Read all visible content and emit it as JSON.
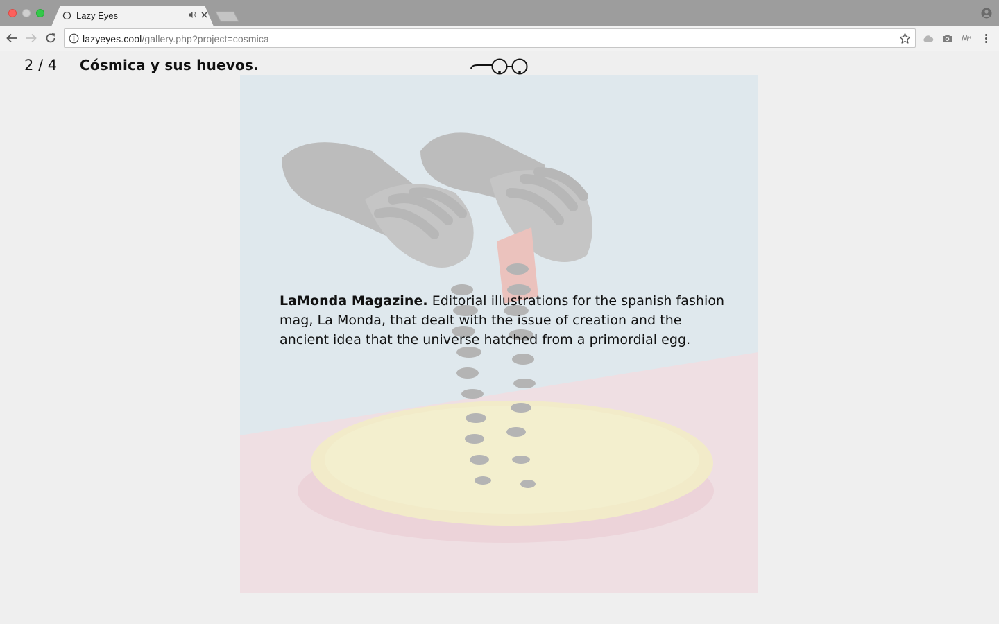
{
  "browser": {
    "tab": {
      "title": "Lazy Eyes"
    },
    "address_bar": {
      "host": "lazyeyes.cool",
      "path": "/gallery.php?project=cosmica"
    },
    "icons": {
      "back": "arrow-left-icon",
      "forward": "arrow-right-icon",
      "reload": "reload-icon",
      "site_info": "info-icon",
      "bookmark": "star-icon",
      "extensions": [
        "cloud-icon",
        "camera-icon",
        "mh-extension-icon"
      ],
      "menu": "kebab-menu-icon",
      "profile": "person-icon"
    }
  },
  "page": {
    "counter": "2 / 4",
    "title": "Cósmica y sus huevos.",
    "logo": "glasses-logo",
    "description": {
      "lead": "LaMonda Magazine.",
      "body": " Editorial illustrations for the spanish fashion mag, La Monda, that dealt with the issue of creation and the ancient idea that the universe hatched from a primordial egg."
    },
    "artwork": "hands-over-plate-illustration"
  }
}
